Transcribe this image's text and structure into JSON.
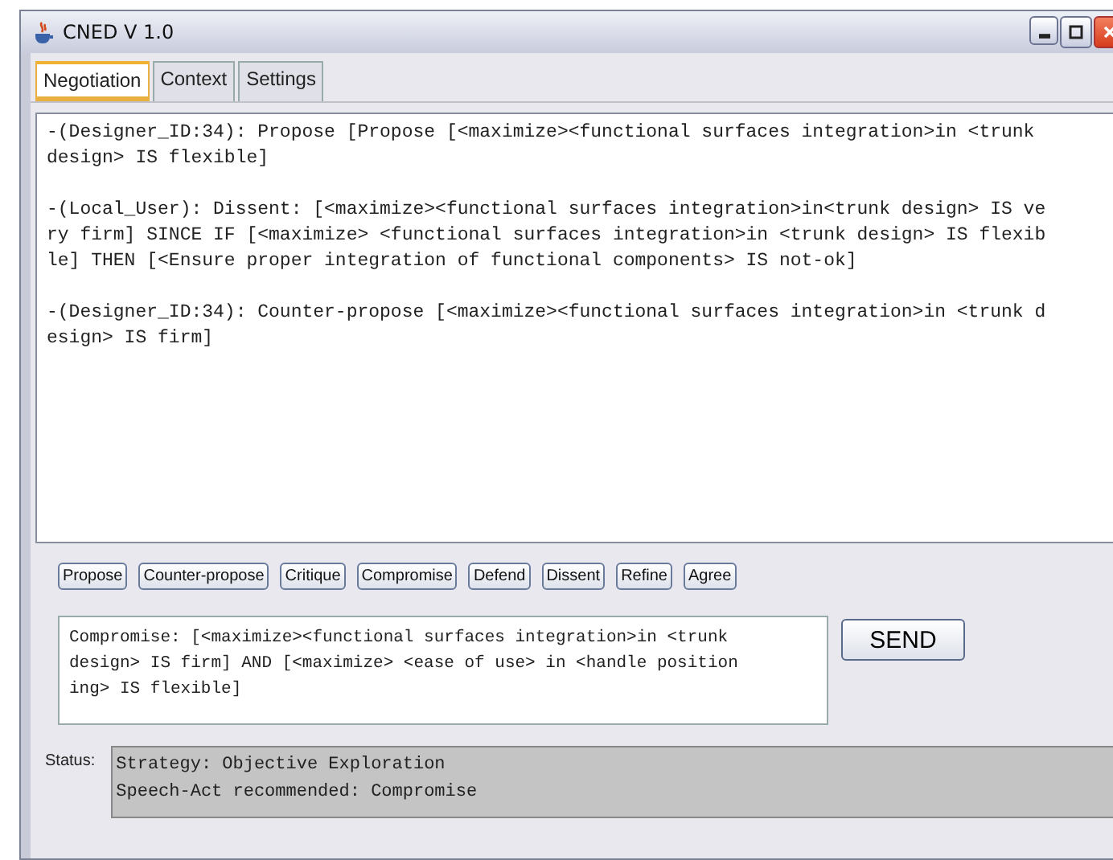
{
  "window": {
    "title": "CNED V 1.0"
  },
  "tabs": [
    {
      "label": "Negotiation",
      "selected": true
    },
    {
      "label": "Context",
      "selected": false
    },
    {
      "label": "Settings",
      "selected": false
    }
  ],
  "log": [
    "-(Designer_ID:34): Propose [Propose [<maximize><functional surfaces integration>in <trunk design> IS flexible]",
    "-(Local_User): Dissent: [<maximize><functional surfaces integration>in<trunk design> IS very firm] SINCE IF [<maximize> <functional surfaces integration>in <trunk design> IS flexible] THEN [<Ensure proper integration of functional components> IS not-ok]",
    "-(Designer_ID:34): Counter-propose [<maximize><functional surfaces integration>in <trunk design> IS firm]"
  ],
  "speech_acts": [
    "Propose",
    "Counter-propose",
    "Critique",
    "Compromise",
    "Defend",
    "Dissent",
    "Refine",
    "Agree"
  ],
  "message": "Compromise: [<maximize><functional surfaces integration>in <trunk design> IS firm] AND [<maximize> <ease of use> in <handle positioning> IS flexible]",
  "send_button": "SEND",
  "status": {
    "label": "Status:",
    "lines": [
      "Strategy: Objective Exploration",
      "Speech-Act recommended: Compromise"
    ]
  }
}
